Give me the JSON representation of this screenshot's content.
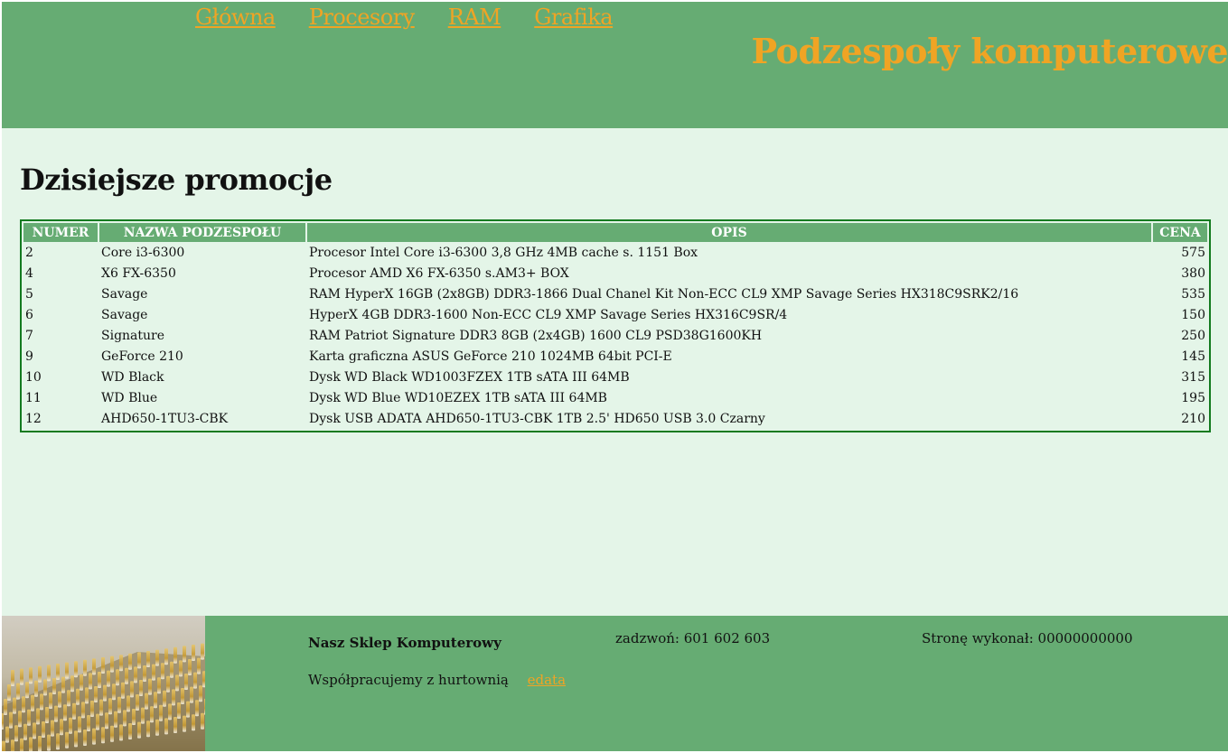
{
  "nav": {
    "items": [
      {
        "label": "Główna"
      },
      {
        "label": "Procesory"
      },
      {
        "label": "RAM"
      },
      {
        "label": "Grafika"
      }
    ]
  },
  "header": {
    "title": "Podzespoły komputerowe"
  },
  "main": {
    "title": "Dzisiejsze promocje",
    "table": {
      "columns": [
        "NUMER",
        "NAZWA PODZESPOŁU",
        "OPIS",
        "CENA"
      ],
      "rows": [
        [
          "2",
          "Core i3-6300",
          "Procesor Intel Core i3-6300 3,8 GHz 4MB cache s. 1151 Box",
          "575"
        ],
        [
          "4",
          "X6 FX-6350",
          "Procesor AMD X6 FX-6350 s.AM3+ BOX",
          "380"
        ],
        [
          "5",
          "Savage",
          "RAM HyperX 16GB (2x8GB) DDR3-1866 Dual Chanel Kit Non-ECC CL9 XMP Savage Series HX318C9SRK2/16",
          "535"
        ],
        [
          "6",
          "Savage",
          "HyperX 4GB DDR3-1600 Non-ECC CL9 XMP Savage Series HX316C9SR/4",
          "150"
        ],
        [
          "7",
          "Signature",
          "RAM Patriot Signature DDR3 8GB (2x4GB) 1600 CL9 PSD38G1600KH",
          "250"
        ],
        [
          "9",
          "GeForce 210",
          "Karta graficzna ASUS GeForce 210 1024MB 64bit PCI-E",
          "145"
        ],
        [
          "10",
          "WD Black",
          "Dysk WD Black WD1003FZEX 1TB sATA III 64MB",
          "315"
        ],
        [
          "11",
          "WD Blue",
          "Dysk WD Blue WD10EZEX 1TB sATA III 64MB",
          "195"
        ],
        [
          "12",
          "AHD650-1TU3-CBK",
          "Dysk USB ADATA AHD650-1TU3-CBK 1TB 2.5' HD650 USB 3.0 Czarny",
          "210"
        ]
      ]
    }
  },
  "footer": {
    "shop_name": "Nasz Sklep Komputerowy",
    "partner_text": "Współpracujemy z hurtownią",
    "partner_link": "edata",
    "phone": "zadzwoń: 601 602 603",
    "author": "Stronę wykonał: 00000000000"
  },
  "colors": {
    "header_bg": "#66ac73",
    "main_bg": "#e4f5e8",
    "accent_orange": "#f0a424",
    "table_border": "#137a1f"
  },
  "icons": {
    "footer_image": "processor-pins-photo"
  }
}
